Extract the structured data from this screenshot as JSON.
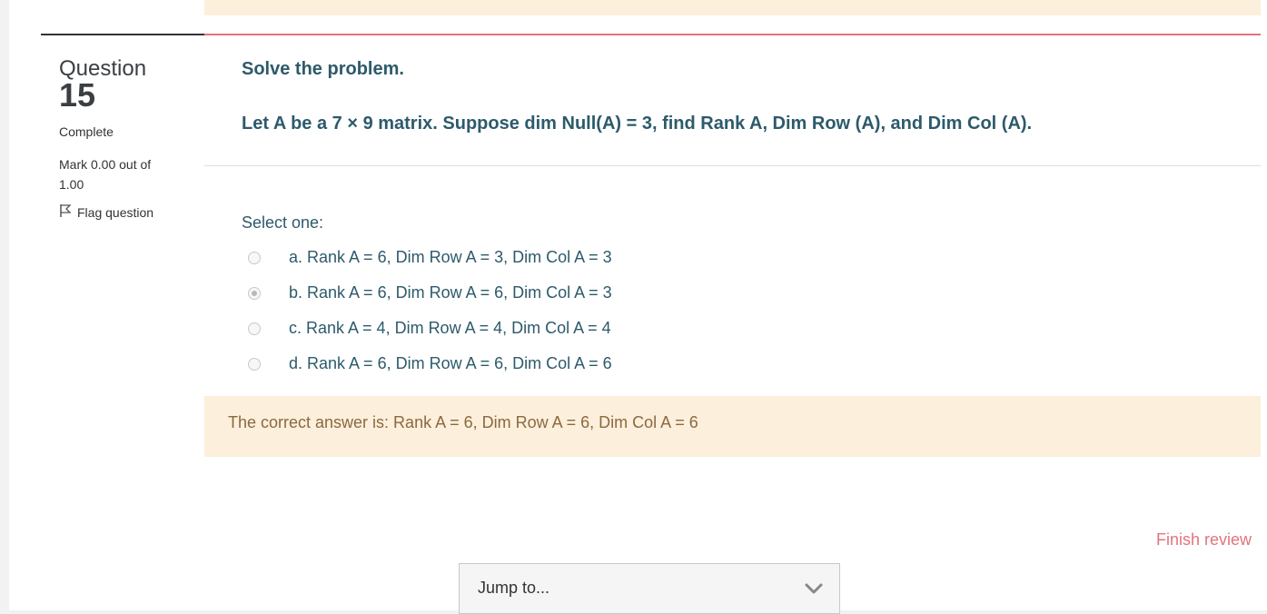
{
  "question": {
    "label": "Question",
    "number": "15",
    "state": "Complete",
    "grade": "Mark 0.00 out of 1.00",
    "flag_label": "Flag question"
  },
  "qtext": {
    "title": "Solve the problem.",
    "body": "Let A be a 7 × 9 matrix. Suppose dim Null(A) = 3, find Rank A, Dim Row (A), and Dim Col (A)."
  },
  "answer": {
    "prompt": "Select one:",
    "options": [
      {
        "label": "a. Rank A = 6, Dim Row A = 3, Dim Col A = 3",
        "selected": false
      },
      {
        "label": "b. Rank A = 6, Dim Row A = 6, Dim Col A = 3",
        "selected": true
      },
      {
        "label": "c. Rank A = 4, Dim Row A = 4, Dim Col A = 4",
        "selected": false
      },
      {
        "label": "d. Rank A = 6, Dim Row A = 6, Dim Col A = 6",
        "selected": false
      }
    ]
  },
  "feedback": {
    "text": "The correct answer is: Rank A = 6, Dim Row A = 6, Dim Col A = 6"
  },
  "nav": {
    "finish_review": "Finish review",
    "jump_to": "Jump to..."
  },
  "colors": {
    "accent": "#e2747c",
    "text_teal": "#2d5a6b",
    "feedback_bg": "#fcefdc"
  }
}
